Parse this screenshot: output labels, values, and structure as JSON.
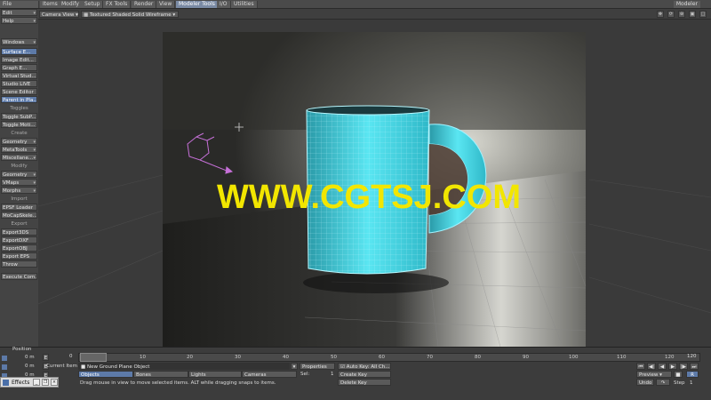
{
  "menubar": {
    "tabs": [
      "File",
      "Items",
      "Modify",
      "Setup",
      "FX Tools",
      "Render",
      "View",
      "Modeler Tools",
      "I/O",
      "Utilities"
    ],
    "modeler_label": "Modeler"
  },
  "left_panel": {
    "file": "File",
    "edit": "Edit",
    "help": "Help",
    "windows": "Windows",
    "window_items": [
      "Surface E...",
      "Image Edit...",
      "Graph E...",
      "Virtual Stud...",
      "Studio LIVE",
      "Scene Editor",
      "Parent in Pla..."
    ],
    "toggles_header": "Toggles",
    "toggle_items": [
      "Toggle SubP...",
      "Toggle Moti..."
    ],
    "create_header": "Create",
    "create_items": [
      "Geometry",
      "MetaTools",
      "Miscellane..."
    ],
    "modify_header": "Modify",
    "modify_items": [
      "Geometry",
      "VMaps",
      "Morphs"
    ],
    "import_header": "Import",
    "import_items": [
      "EPSF Loader",
      "MoCapSkele..."
    ],
    "export_header": "Export",
    "export_items": [
      "Export3DS",
      "ExportDXF",
      "ExportOBJ",
      "Export EPS",
      "Throw"
    ],
    "execute": "Execute Com..."
  },
  "viewport": {
    "camera_view": "Camera View",
    "render_mode": "Textured Shaded Solid Wireframe",
    "watermark": "WWW.CGTSJ.COM"
  },
  "timeline": {
    "position_label": "Position",
    "rows": [
      "0 m",
      "0 m",
      "0 m"
    ],
    "current_item_label": "Current Item",
    "current_item": "New Ground Plane Object",
    "objects": "Objects",
    "bones": "Bones",
    "lights": "Lights",
    "cameras": "Cameras",
    "properties": "Properties",
    "sel_label": "Sel:",
    "sel_value": "1",
    "auto_key": "Auto Key: All Ch...",
    "create_key": "Create Key",
    "delete_key": "Delete Key",
    "hint": "Drag mouse in view to move selected items. ALT while dragging snaps to items.",
    "ruler_ticks": [
      "0",
      "10",
      "20",
      "30",
      "40",
      "50",
      "60",
      "70",
      "80",
      "90",
      "100",
      "110",
      "120"
    ],
    "end_frame": "120",
    "start_frame": "0",
    "preview": "Preview",
    "undo": "Undo",
    "step_label": "Step",
    "step_value": "1",
    "effects_tab": "Effects"
  },
  "colors": {
    "accent": "#5d7aa8",
    "wireframe": "#3fd8e8",
    "watermark": "#f2e600"
  }
}
